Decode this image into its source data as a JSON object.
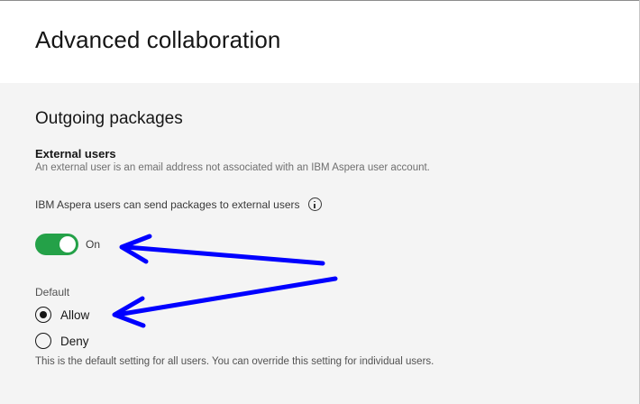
{
  "page": {
    "title": "Advanced collaboration"
  },
  "outgoing": {
    "section_title": "Outgoing packages",
    "external_heading": "External users",
    "external_description": "An external user is an email address not associated with an IBM Aspera user account.",
    "toggle_label": "IBM Aspera users can send packages to external users",
    "toggle_state_text": "On",
    "toggle_on": true,
    "default_label": "Default",
    "options": [
      {
        "label": "Allow",
        "selected": true
      },
      {
        "label": "Deny",
        "selected": false
      }
    ],
    "helper_text": "This is the default setting for all users. You can override this setting for individual users."
  },
  "icons": {
    "info": "info-circle-icon",
    "toggle_arrow": "annotation-arrow-icon",
    "radio_arrow": "annotation-arrow-icon"
  },
  "colors": {
    "toggle_on": "#24a148",
    "annotation": "#0000ff",
    "panel_background": "#f4f4f4"
  }
}
